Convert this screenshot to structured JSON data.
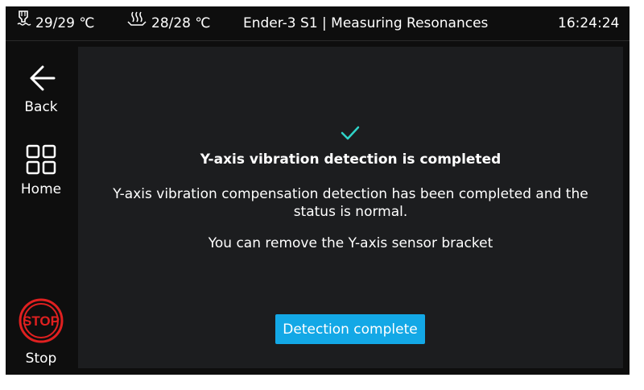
{
  "statusbar": {
    "nozzle_icon": "nozzle-temperature-icon",
    "nozzle_temp": "29/29 ℃",
    "bed_icon": "bed-temperature-icon",
    "bed_temp": "28/28 ℃",
    "title": "Ender-3 S1 | Measuring Resonances",
    "time": "16:24:24"
  },
  "sidebar": {
    "back": {
      "icon": "arrow-left-icon",
      "label": "Back"
    },
    "home": {
      "icon": "grid-icon",
      "label": "Home"
    },
    "stop": {
      "icon": "stop-icon",
      "icon_text": "STOP",
      "label": "Stop"
    }
  },
  "dialog": {
    "icon": "check-icon",
    "heading": "Y-axis vibration detection is completed",
    "description": "Y-axis vibration compensation detection has been completed and the status is normal.",
    "note": "You can remove the Y-axis sensor bracket",
    "button_label": "Detection complete"
  },
  "colors": {
    "background": "#0e0e0e",
    "panel": "#1c1d1f",
    "accent": "#13a8e6",
    "check": "#2fd3c8",
    "stop": "#e02020"
  }
}
